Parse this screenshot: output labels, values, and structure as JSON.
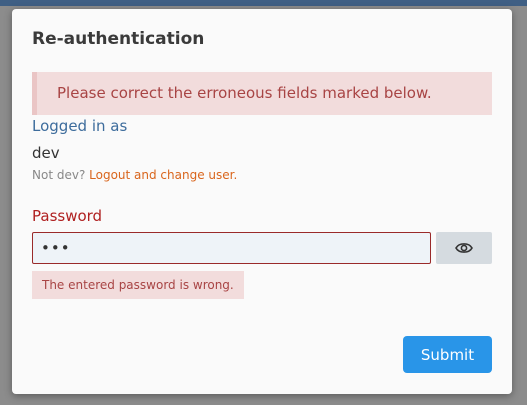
{
  "dialog": {
    "title": "Re-authentication",
    "alert": "Please correct the erroneous fields marked below."
  },
  "user": {
    "logged_in_label": "Logged in as",
    "name": "dev",
    "not_user_prefix": "Not dev?",
    "logout_link": "Logout and change user."
  },
  "password": {
    "label": "Password",
    "value": "•••",
    "error": "The entered password is wrong.",
    "toggle_icon": "eye-icon"
  },
  "actions": {
    "submit": "Submit"
  },
  "colors": {
    "primary": "#2995e8",
    "error": "#b02020",
    "link": "#d9651c",
    "label": "#3d6c9c"
  }
}
